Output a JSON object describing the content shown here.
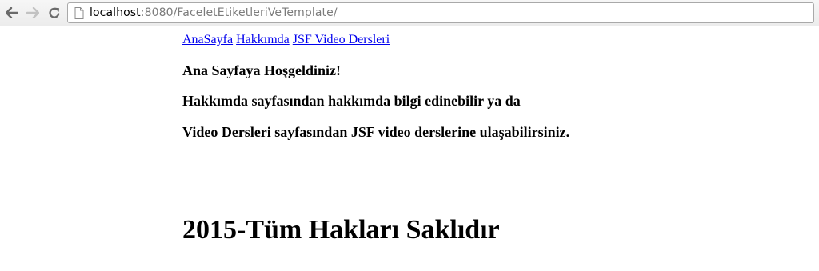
{
  "browser": {
    "url_host": "localhost",
    "url_path": ":8080/FaceletEtiketleriVeTemplate/",
    "back_icon": "back-arrow-icon",
    "forward_icon": "forward-arrow-icon",
    "reload_icon": "reload-icon",
    "page_icon": "page-icon"
  },
  "nav": {
    "links": [
      "AnaSayfa",
      "Hakkımda",
      "JSF Video Dersleri"
    ]
  },
  "main": {
    "welcome": "Ana Sayfaya Hoşgeldiniz!",
    "line2": "Hakkımda sayfasından hakkımda bilgi edinebilir ya da",
    "line3": "Video Dersleri sayfasından JSF video derslerine ulaşabilirsiniz."
  },
  "footer": {
    "text": "2015-Tüm Hakları Saklıdır"
  },
  "colors": {
    "link": "#0000ee",
    "text": "#000000"
  }
}
